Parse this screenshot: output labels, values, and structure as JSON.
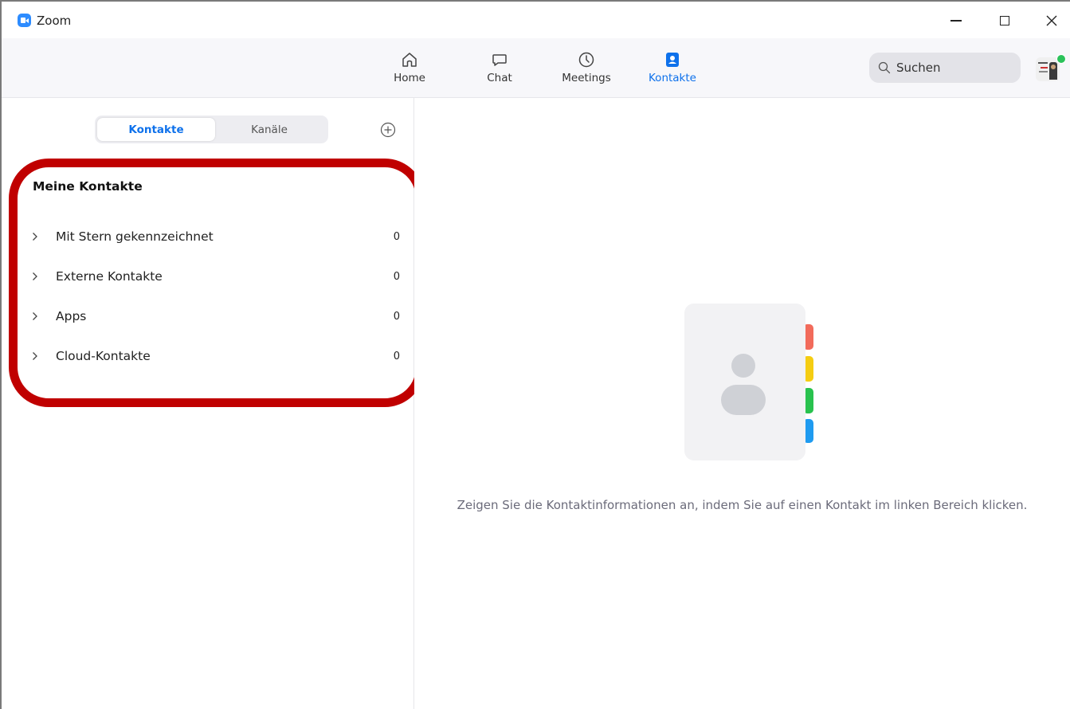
{
  "window": {
    "title": "Zoom",
    "app_icon": "zoom-camera-icon",
    "controls": [
      "minimize-icon",
      "maximize-icon",
      "close-icon"
    ]
  },
  "toolbar": {
    "tabs": [
      {
        "label": "Home",
        "icon": "home-icon",
        "active": false
      },
      {
        "label": "Chat",
        "icon": "chat-bubble-icon",
        "active": false
      },
      {
        "label": "Meetings",
        "icon": "clock-icon",
        "active": false
      },
      {
        "label": "Kontakte",
        "icon": "contact-card-icon",
        "active": true
      }
    ],
    "search": {
      "placeholder": "Suchen",
      "icon": "search-icon"
    },
    "avatar": {
      "presence": "online",
      "presence_color": "#2bc25a"
    }
  },
  "sidebar": {
    "segments": [
      {
        "label": "Kontakte",
        "active": true
      },
      {
        "label": "Kanäle",
        "active": false
      }
    ],
    "add_icon": "plus-circle-icon",
    "group_title": "Meine Kontakte",
    "groups": [
      {
        "label": "Mit Stern gekennzeichnet",
        "count": "0"
      },
      {
        "label": "Externe Kontakte",
        "count": "0"
      },
      {
        "label": "Apps",
        "count": "0"
      },
      {
        "label": "Cloud-Kontakte",
        "count": "0"
      }
    ]
  },
  "main": {
    "illustration": "address-book-icon",
    "empty_message": "Zeigen Sie die Kontaktinformationen an, indem Sie auf einen Kontakt im linken Bereich klicken."
  },
  "colors": {
    "accent": "#0e71eb",
    "highlight": "#c00000",
    "tab_red": "#f26b5b",
    "tab_yellow": "#f5cd12",
    "tab_green": "#29c24e",
    "tab_blue": "#1f9bf0"
  }
}
